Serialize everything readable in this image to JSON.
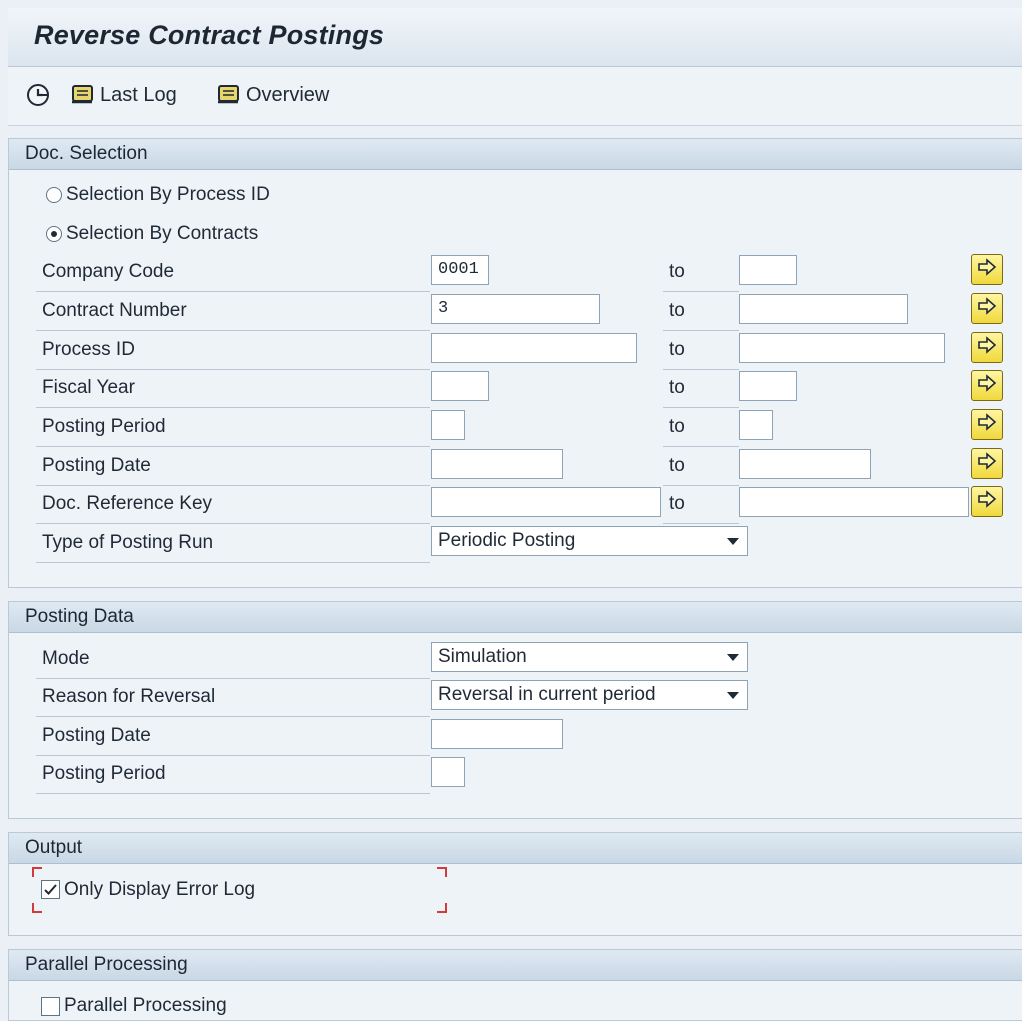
{
  "window": {
    "title": "Reverse Contract Postings"
  },
  "toolbar": {
    "execute_icon": "execute-clock-icon",
    "last_log_label": "Last Log",
    "overview_label": "Overview"
  },
  "doc_selection": {
    "header": "Doc. Selection",
    "radio_process_id": {
      "label": "Selection By Process ID",
      "selected": false
    },
    "radio_contracts": {
      "label": "Selection By Contracts",
      "selected": true
    },
    "to_label": "to",
    "fields": {
      "company_code": {
        "label": "Company Code",
        "from": "0001",
        "to": ""
      },
      "contract_number": {
        "label": "Contract Number",
        "from": "3",
        "to": ""
      },
      "process_id": {
        "label": "Process ID",
        "from": "",
        "to": ""
      },
      "fiscal_year": {
        "label": "Fiscal Year",
        "from": "",
        "to": ""
      },
      "posting_period": {
        "label": "Posting Period",
        "from": "",
        "to": ""
      },
      "posting_date": {
        "label": "Posting Date",
        "from": "",
        "to": ""
      },
      "doc_reference_key": {
        "label": "Doc. Reference Key",
        "from": "",
        "to": ""
      }
    },
    "type_of_posting_run": {
      "label": "Type of Posting Run",
      "value": "Periodic Posting"
    }
  },
  "posting_data": {
    "header": "Posting Data",
    "mode": {
      "label": "Mode",
      "value": "Simulation"
    },
    "reason_for_reversal": {
      "label": "Reason for Reversal",
      "value": "Reversal in current period"
    },
    "posting_date": {
      "label": "Posting Date",
      "value": ""
    },
    "posting_period": {
      "label": "Posting Period",
      "value": ""
    }
  },
  "output": {
    "header": "Output",
    "only_display_error_log": {
      "label": "Only Display Error Log",
      "checked": true
    }
  },
  "parallel": {
    "header": "Parallel Processing",
    "parallel_processing": {
      "label": "Parallel Processing",
      "checked": false
    }
  },
  "colors": {
    "accent_button": "#f0d83b",
    "panel_header": "#c9d8e6",
    "highlight_corners": "#d23b3b"
  }
}
